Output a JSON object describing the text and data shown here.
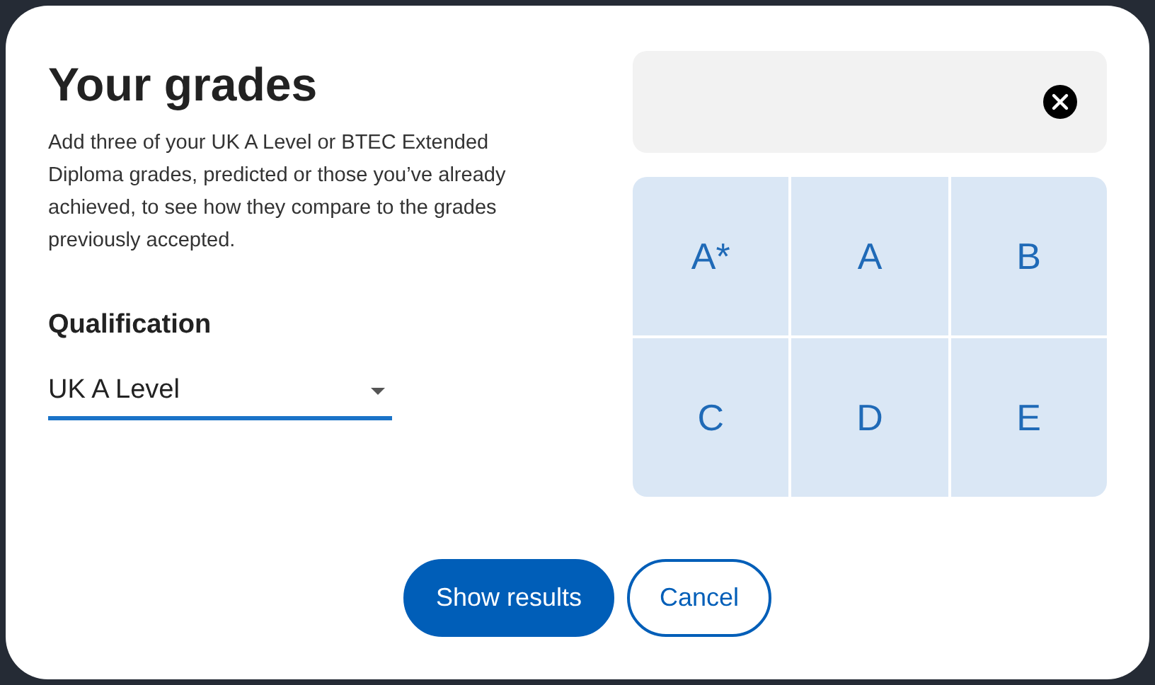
{
  "title": "Your grades",
  "description": "Add three of your UK A Level or BTEC Extended Diploma grades, predicted or those you’ve already achieved, to see how they compare to the grades previously accepted.",
  "qualification": {
    "label": "Qualification",
    "value": "UK A Level"
  },
  "grades": [
    {
      "label": "A*",
      "selected": false
    },
    {
      "label": "A",
      "selected": false
    },
    {
      "label": "B",
      "selected": false
    },
    {
      "label": "C",
      "selected": false
    },
    {
      "label": "D",
      "selected": false
    },
    {
      "label": "E",
      "selected": false
    }
  ],
  "buttons": [
    {
      "label": "Show results",
      "kind": "primary"
    },
    {
      "label": "Cancel",
      "kind": "secondary"
    }
  ]
}
